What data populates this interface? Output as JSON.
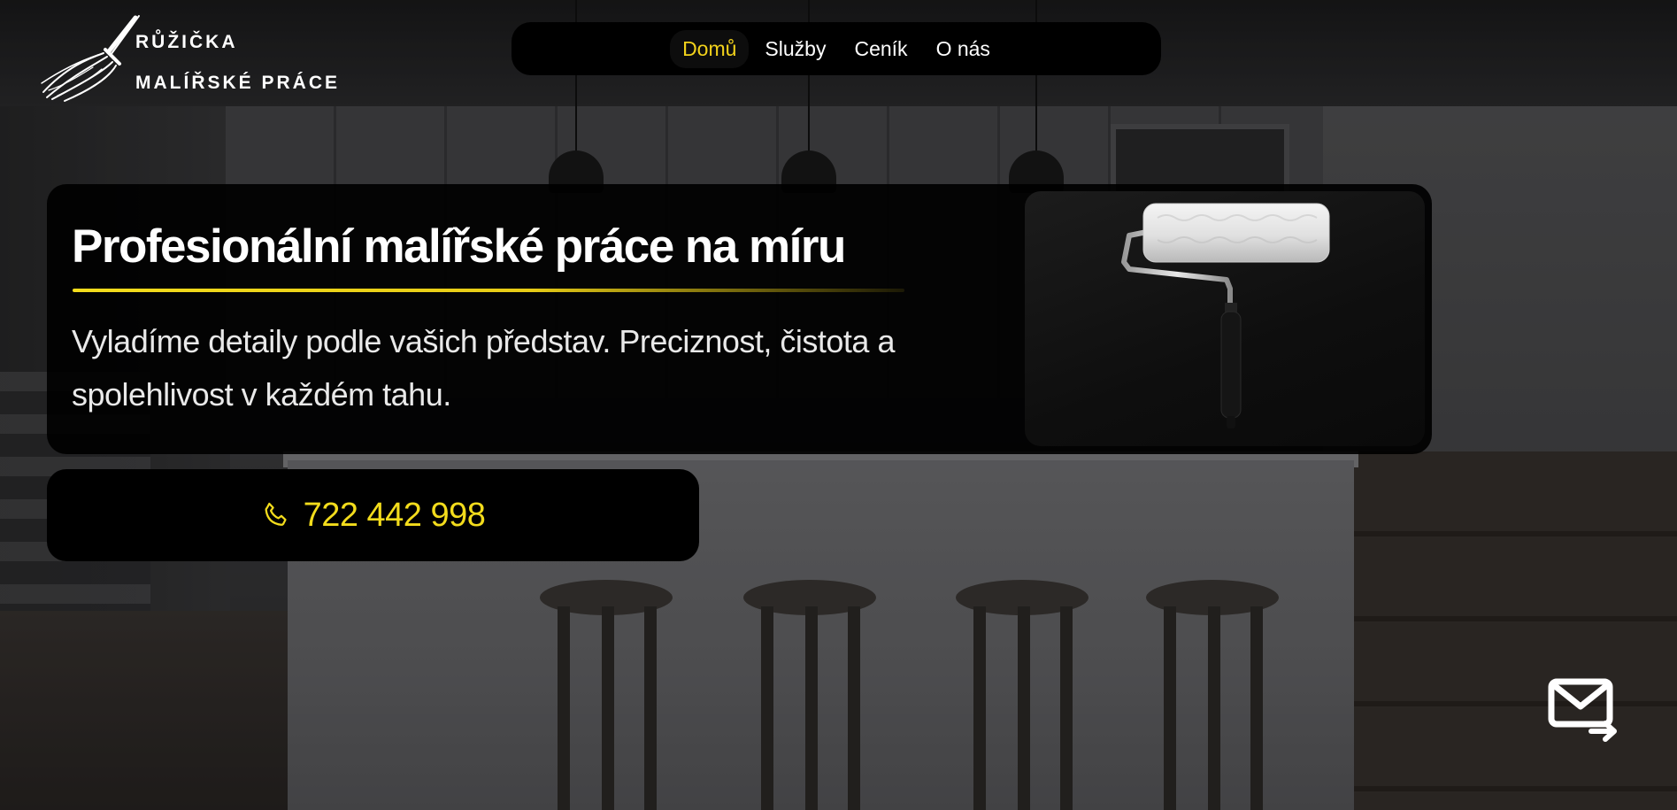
{
  "brand": {
    "name": "RŮŽIČKA",
    "tagline": "MALÍŘSKÉ PRÁCE"
  },
  "nav": {
    "items": [
      {
        "label": "Domů",
        "active": true
      },
      {
        "label": "Služby",
        "active": false
      },
      {
        "label": "Ceník",
        "active": false
      },
      {
        "label": "O nás",
        "active": false
      }
    ]
  },
  "hero": {
    "title": "Profesionální malířské práce na míru",
    "description": "Vyladíme detaily podle vašich představ. Preciznost, čistota a spolehlivost v každém tahu."
  },
  "contact": {
    "phone": "722 442 998"
  },
  "colors": {
    "accent": "#f3dc1c",
    "card_background": "#000000",
    "text": "#ffffff"
  },
  "icons": {
    "logo": "paint-brush-icon",
    "phone": "phone-icon",
    "mail": "mail-send-icon",
    "hero_image": "paint-roller-image"
  }
}
